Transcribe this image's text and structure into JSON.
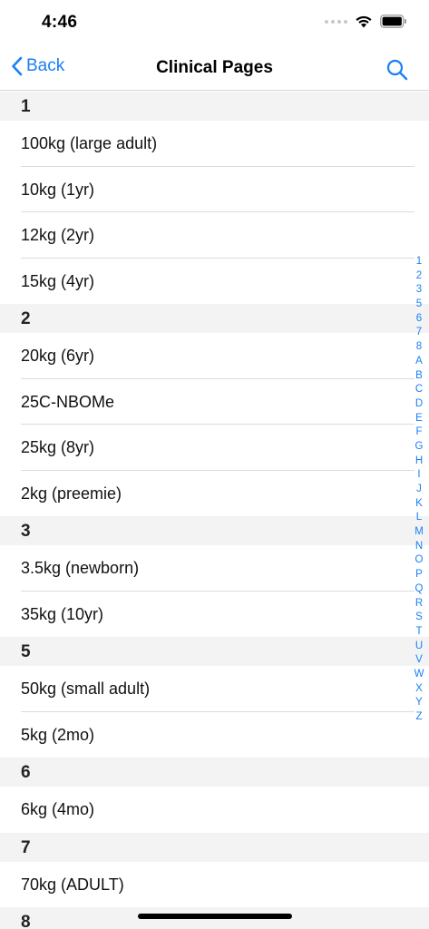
{
  "status": {
    "time": "4:46"
  },
  "nav": {
    "back_label": "Back",
    "title": "Clinical Pages"
  },
  "sections": [
    {
      "header": "1",
      "items": [
        "100kg (large adult)",
        "10kg (1yr)",
        "12kg (2yr)",
        "15kg (4yr)"
      ]
    },
    {
      "header": "2",
      "items": [
        "20kg (6yr)",
        "25C-NBOMe",
        "25kg (8yr)",
        "2kg (preemie)"
      ]
    },
    {
      "header": "3",
      "items": [
        "3.5kg (newborn)",
        "35kg (10yr)"
      ]
    },
    {
      "header": "5",
      "items": [
        "50kg (small adult)",
        "5kg (2mo)"
      ]
    },
    {
      "header": "6",
      "items": [
        "6kg (4mo)"
      ]
    },
    {
      "header": "7",
      "items": [
        "70kg (ADULT)"
      ]
    },
    {
      "header": "8",
      "items": []
    }
  ],
  "index": [
    "1",
    "2",
    "3",
    "5",
    "6",
    "7",
    "8",
    "A",
    "B",
    "C",
    "D",
    "E",
    "F",
    "G",
    "H",
    "I",
    "J",
    "K",
    "L",
    "M",
    "N",
    "O",
    "P",
    "Q",
    "R",
    "S",
    "T",
    "U",
    "V",
    "W",
    "X",
    "Y",
    "Z"
  ],
  "colors": {
    "accent": "#1a7ff5",
    "section_bg": "#f3f3f4"
  }
}
